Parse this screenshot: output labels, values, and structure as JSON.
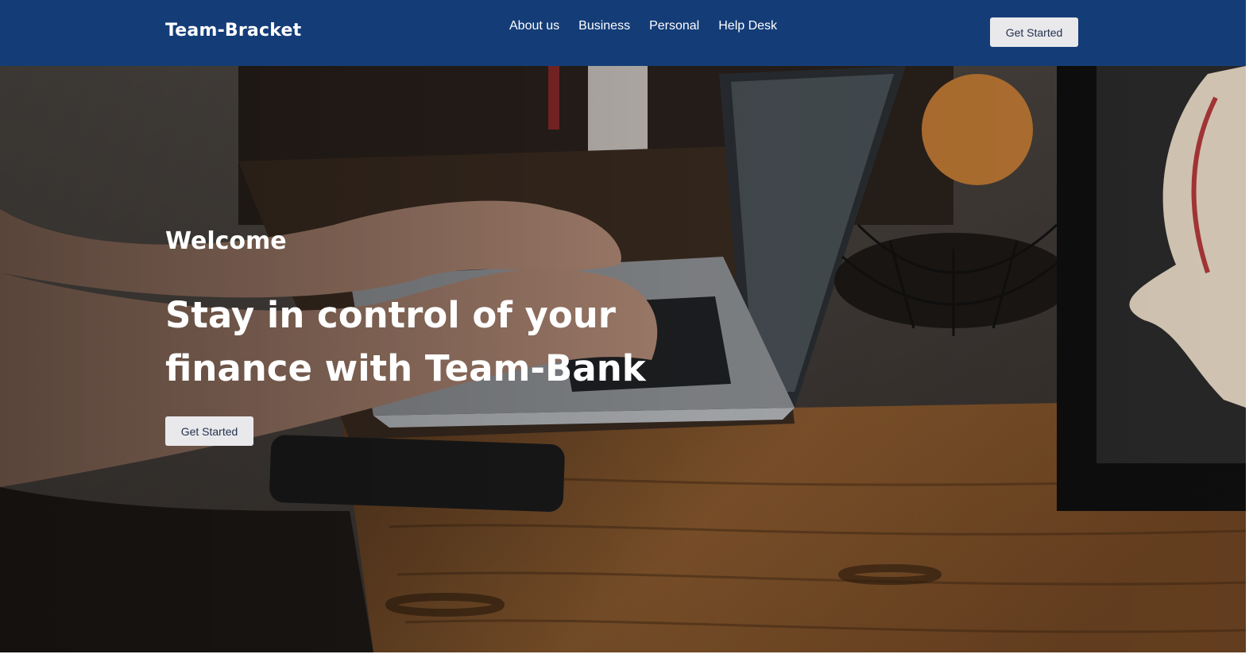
{
  "header": {
    "brand": "Team-Bracket",
    "nav": [
      "About us",
      "Business",
      "Personal",
      "Help Desk"
    ],
    "cta_label": "Get Started"
  },
  "hero": {
    "welcome": "Welcome",
    "headline": "Stay in control of your finance with Team-Bank",
    "cta_label": "Get Started"
  },
  "colors": {
    "navbar": "#143d78",
    "button_bg": "#e9e9ec",
    "button_text": "#23324d"
  }
}
